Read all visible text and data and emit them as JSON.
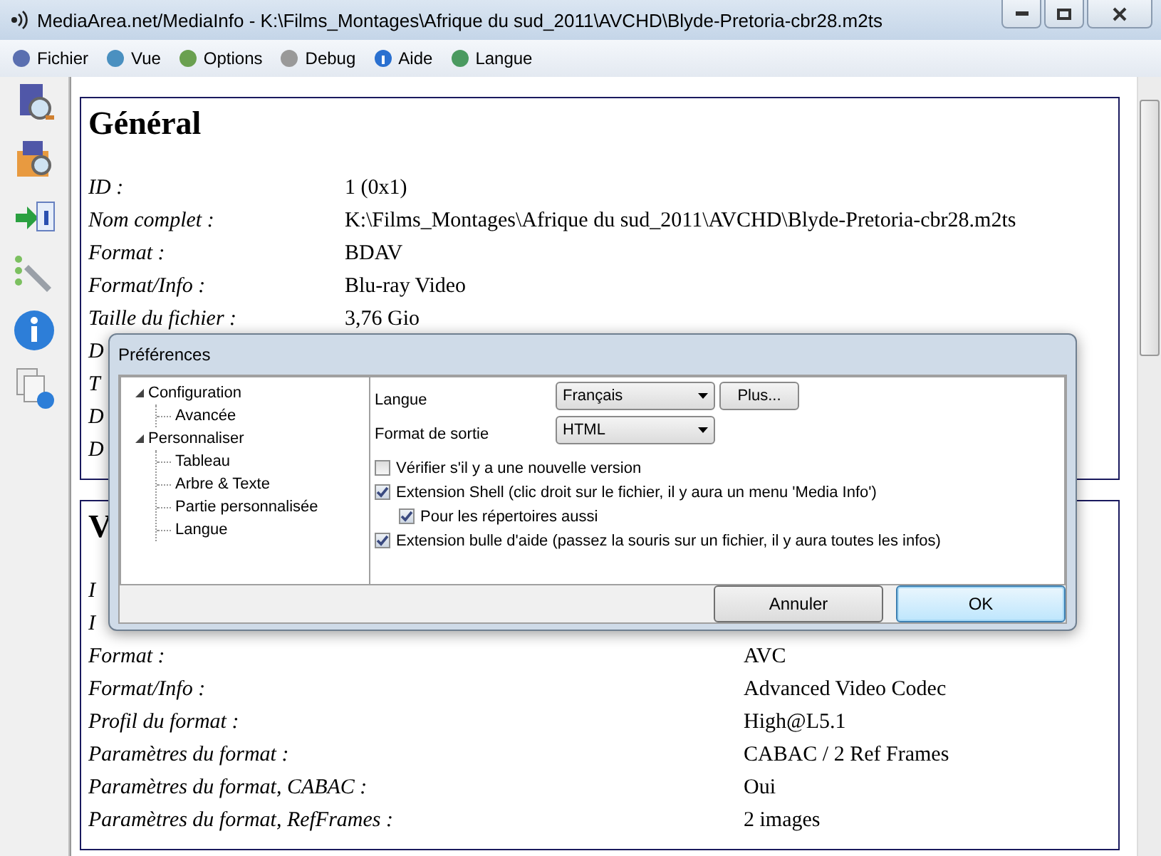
{
  "window": {
    "title": "MediaArea.net/MediaInfo - K:\\Films_Montages\\Afrique du sud_2011\\AVCHD\\Blyde-Pretoria-cbr28.m2ts"
  },
  "menu": [
    {
      "label": "Fichier"
    },
    {
      "label": "Vue"
    },
    {
      "label": "Options"
    },
    {
      "label": "Debug"
    },
    {
      "label": "Aide"
    },
    {
      "label": "Langue"
    }
  ],
  "sections": [
    {
      "heading": "Général",
      "rows": [
        {
          "label": "ID :",
          "value": "1 (0x1)"
        },
        {
          "label": "Nom complet :",
          "value": "K:\\Films_Montages\\Afrique du sud_2011\\AVCHD\\Blyde-Pretoria-cbr28.m2ts"
        },
        {
          "label": "Format :",
          "value": "BDAV"
        },
        {
          "label": "Format/Info :",
          "value": "Blu-ray Video"
        },
        {
          "label": "Taille du fichier :",
          "value": "3,76 Gio"
        },
        {
          "label": "D"
        },
        {
          "label": "T"
        },
        {
          "label": "D"
        },
        {
          "label": "D"
        }
      ]
    },
    {
      "heading": "V",
      "rows": [
        {
          "label": "I"
        },
        {
          "label": "I"
        },
        {
          "label": "Format :",
          "value": "AVC"
        },
        {
          "label": "Format/Info :",
          "value": "Advanced Video Codec"
        },
        {
          "label": "Profil du format :",
          "value": "High@L5.1"
        },
        {
          "label": "Paramètres du format :",
          "value": "CABAC / 2 Ref Frames"
        },
        {
          "label": "Paramètres du format, CABAC :",
          "value": "Oui"
        },
        {
          "label": "Paramètres du format, RefFrames :",
          "value": "2 images"
        }
      ]
    }
  ],
  "dialog": {
    "title": "Préférences",
    "tree": [
      {
        "label": "Configuration",
        "expanded": true,
        "children": [
          {
            "label": "Avancée"
          }
        ]
      },
      {
        "label": "Personnaliser",
        "expanded": true,
        "children": [
          {
            "label": "Tableau"
          },
          {
            "label": "Arbre & Texte"
          },
          {
            "label": "Partie personnalisée"
          },
          {
            "label": "Langue"
          }
        ]
      }
    ],
    "fields": [
      {
        "label": "Langue",
        "value": "Français",
        "button": "Plus..."
      },
      {
        "label": "Format de sortie",
        "value": "HTML"
      }
    ],
    "options": [
      {
        "label": "Vérifier s'il y a une nouvelle version",
        "checked": false
      },
      {
        "label": "Extension Shell (clic droit sur le fichier, il y aura un menu 'Media Info')",
        "checked": true,
        "children": [
          {
            "label": "Pour les répertoires aussi",
            "checked": true
          }
        ]
      },
      {
        "label": "Extension bulle d'aide (passez la souris sur un fichier, il y aura toutes les infos)",
        "checked": true
      }
    ],
    "buttons": [
      {
        "label": "Annuler",
        "default": false
      },
      {
        "label": "OK",
        "default": true
      }
    ]
  }
}
